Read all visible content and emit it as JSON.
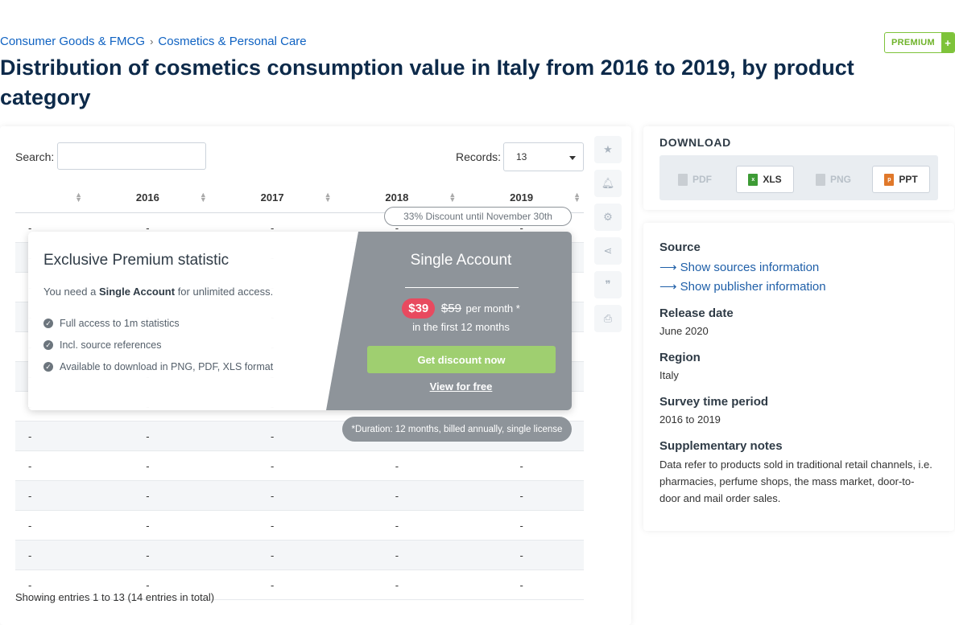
{
  "breadcrumb": {
    "category": "Consumer Goods & FMCG",
    "separator": "›",
    "subcategory": "Cosmetics & Personal Care"
  },
  "premium_badge": {
    "label": "PREMIUM",
    "plus": "+"
  },
  "title": "Distribution of cosmetics consumption value in Italy from 2016 to 2019, by product category",
  "table": {
    "search_label": "Search:",
    "search_value": "",
    "records_label": "Records:",
    "records_value": "13",
    "headers": [
      "",
      "2016",
      "2017",
      "2018",
      "2019"
    ],
    "rows": [
      [
        "-",
        "-",
        "-",
        "-",
        "-"
      ],
      [
        "-",
        "-",
        "-",
        "-",
        "-"
      ],
      [
        "-",
        "-",
        "-",
        "-",
        "-"
      ],
      [
        "-",
        "-",
        "-",
        "-",
        "-"
      ],
      [
        "-",
        "-",
        "-",
        "-",
        "-"
      ],
      [
        "-",
        "-",
        "-",
        "-",
        "-"
      ],
      [
        "-",
        "-",
        "-",
        "-",
        "-"
      ],
      [
        "-",
        "-",
        "-",
        "-",
        "-"
      ],
      [
        "-",
        "-",
        "-",
        "-",
        "-"
      ],
      [
        "-",
        "-",
        "-",
        "-",
        "-"
      ],
      [
        "-",
        "-",
        "-",
        "-",
        "-"
      ],
      [
        "-",
        "-",
        "-",
        "-",
        "-"
      ],
      [
        "-",
        "-",
        "-",
        "-",
        "-"
      ]
    ],
    "showing": "Showing entries 1 to 13 (14 entries in total)"
  },
  "tools": [
    "star-icon",
    "bell-icon",
    "gear-icon",
    "share-icon",
    "quote-icon",
    "print-icon"
  ],
  "paywall": {
    "discount": "33% Discount until November 30th",
    "title": "Exclusive Premium statistic",
    "subtitle_pre": "You need a ",
    "subtitle_bold": "Single Account",
    "subtitle_post": " for unlimited access.",
    "features": [
      "Full access to 1m statistics",
      "Incl. source references",
      "Available to download in PNG, PDF, XLS format"
    ],
    "account_name": "Single Account",
    "price_new": "$39",
    "price_old": "$59",
    "price_unit": "per month *",
    "period": "in the first 12 months",
    "cta": "Get discount now",
    "free_link": "View for free",
    "duration_note": "*Duration: 12 months, billed annually, single license"
  },
  "download": {
    "title": "DOWNLOAD",
    "buttons": [
      {
        "label": "PDF",
        "enabled": false,
        "color": "#c9ced3"
      },
      {
        "label": "XLS",
        "enabled": true,
        "color": "#3d9b35"
      },
      {
        "label": "PNG",
        "enabled": false,
        "color": "#c9ced3"
      },
      {
        "label": "PPT",
        "enabled": true,
        "color": "#e0782a"
      }
    ]
  },
  "meta": {
    "source_label": "Source",
    "show_sources": "Show sources information",
    "show_publisher": "Show publisher information",
    "release_label": "Release date",
    "release_value": "June 2020",
    "region_label": "Region",
    "region_value": "Italy",
    "survey_label": "Survey time period",
    "survey_value": "2016 to 2019",
    "notes_label": "Supplementary notes",
    "notes_value": "Data refer to products sold in traditional retail channels, i.e. pharmacies, perfume shops, the mass market, door-to-door and mail order sales."
  }
}
